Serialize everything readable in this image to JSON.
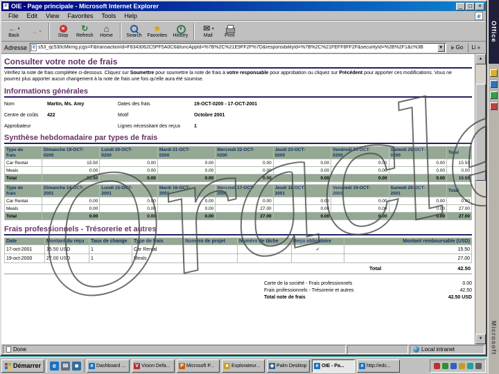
{
  "colors": {
    "titlebar_left": "#000080",
    "titlebar_right": "#1084d0",
    "chrome": "#c0c0c0",
    "desktop": "#008080",
    "heading": "#663366",
    "rule": "#202060",
    "table_header_bg": "#94a894",
    "table_header_text": "#14306a",
    "table_total_bg": "#94a894",
    "watermark_stroke": "#4a4a4a"
  },
  "window": {
    "title": "OIE - Page principale - Microsoft Internet Explorer",
    "menu_items": [
      "File",
      "Edit",
      "View",
      "Favorites",
      "Tools",
      "Help"
    ],
    "toolbar": [
      {
        "label": "Back",
        "icon": "back",
        "dropdown": true
      },
      {
        "label": "",
        "icon": "forward",
        "name": "forward",
        "dropdown": true,
        "disabled": true
      },
      {
        "sep": true
      },
      {
        "label": "Stop",
        "icon": "stop"
      },
      {
        "label": "Refresh",
        "icon": "refresh"
      },
      {
        "label": "Home",
        "icon": "home"
      },
      {
        "sep": true
      },
      {
        "label": "Search",
        "icon": "search"
      },
      {
        "label": "Favorites",
        "icon": "favorites"
      },
      {
        "label": "History",
        "icon": "history"
      },
      {
        "sep": true
      },
      {
        "label": "Mail",
        "icon": "mail",
        "dropdown": true
      },
      {
        "label": "Print",
        "icon": "print"
      }
    ],
    "address_label": "Adresse",
    "address_value": "s53_qc530cMkmg.jcgs=F&transactionId=F8343062C5PF5A0C6&funcAppId=%7B%2C%21E9FF2F%7D&responsibilityId=%7B%2C%21FEFF8FF2F&securityId=%2B%2F1&c%3B",
    "go_label": "Go",
    "links_label": "Li"
  },
  "page": {
    "title": "Consulter votre note de frais",
    "intro": [
      {
        "t": "Vérifiez la note de frais complétée ci-dessous. Cliquez sur "
      },
      {
        "t": "Soumettre",
        "b": true
      },
      {
        "t": " pour soumettre la note de frais à "
      },
      {
        "t": "votre responsable",
        "b": true
      },
      {
        "t": " pour approbation ou cliquez sur "
      },
      {
        "t": "Précédent",
        "b": true
      },
      {
        "t": " pour apporter ces modifications. Vous ne pourrez plus apporter aucun changement à la note de frais une fois qu'elle aura été soumise."
      }
    ],
    "general": {
      "title": "Informations générales",
      "fields_left": [
        {
          "label": "Nom",
          "value": "Martin, Ms. Amy"
        },
        {
          "label": "Centre de coûts",
          "value": "422"
        },
        {
          "label": "Approbateur",
          "value": ""
        }
      ],
      "fields_right": [
        {
          "label": "Dates des frais",
          "value": "19-OCT-0200  -  17-OCT-2001"
        },
        {
          "label": "Motif",
          "value": "Octobre 2001"
        },
        {
          "label": "Lignes nécessitant des reçus",
          "value": "1"
        }
      ]
    },
    "weekly_title": "Synthèse hebdomadaire par types de frais",
    "weeks": [
      {
        "headers": [
          [
            "Type de",
            "frais"
          ],
          [
            "Dimanche 19-OCT-",
            "0200"
          ],
          [
            "Lundi 20-OCT-",
            "0200"
          ],
          [
            "Mardi 21-OCT-",
            "0200"
          ],
          [
            "Mercredi 22-OCT-",
            "0200"
          ],
          [
            "Jeudi 23-OCT-",
            "0200"
          ],
          [
            "Vendredi 24-OCT-",
            "0200"
          ],
          [
            "Samedi 25-OCT-",
            "0200"
          ],
          [
            "Total"
          ]
        ],
        "rows": [
          {
            "label": "Car Rental",
            "values": [
              "15.50",
              "0.00",
              "0.00",
              "0.00",
              "0.00",
              "0.00",
              "0.00",
              "15.50"
            ]
          },
          {
            "label": "Meals",
            "values": [
              "0.00",
              "0.00",
              "0.00",
              "0.00",
              "0.00",
              "0.00",
              "0.00",
              "0.00"
            ]
          }
        ],
        "total": {
          "label": "Total",
          "values": [
            "15.50",
            "0.00",
            "0.00",
            "0.00",
            "0.00",
            "0.00",
            "0.00",
            "15.50"
          ]
        }
      },
      {
        "headers": [
          [
            "Type de",
            "frais"
          ],
          [
            "Dimanche 14-OCT-",
            "2001"
          ],
          [
            "Lundi 15-OCT-",
            "2001"
          ],
          [
            "Mardi 16-OCT-",
            "2001"
          ],
          [
            "Mercredi 17-OCT-",
            "2001"
          ],
          [
            "Jeudi 18-OCT-",
            "2001"
          ],
          [
            "Vendredi 19-OCT-",
            "2001"
          ],
          [
            "Samedi 20-OCT-",
            "2001"
          ],
          [
            "Total"
          ]
        ],
        "rows": [
          {
            "label": "Car Rental",
            "values": [
              "0.00",
              "0.00",
              "0.00",
              "0.00",
              "0.00",
              "0.00",
              "0.00",
              "0.00"
            ]
          },
          {
            "label": "Meals",
            "values": [
              "0.00",
              "0.00",
              "0.00",
              "27.00",
              "0.00",
              "0.00",
              "0.00",
              "27.00"
            ]
          }
        ],
        "total": {
          "label": "Total",
          "values": [
            "0.00",
            "0.00",
            "0.00",
            "27.00",
            "0.00",
            "0.00",
            "0.00",
            "27.00"
          ]
        }
      }
    ],
    "details": {
      "title": "Frais professionnels - Trésorerie et autres",
      "headers": [
        "Date",
        "Montant du reçu",
        "Taux de change",
        "Type de frais",
        "Numéro de projet",
        "Numéro de tâche",
        "Reçu obligatoire",
        "Montant remboursable (USD)"
      ],
      "rows": [
        [
          "17-oct-2001",
          "15.50 USD",
          "1",
          "Car Rental",
          "",
          "",
          "✓",
          "15.50"
        ],
        [
          "19-oct-2000",
          "27.00 USD",
          "1",
          "Meals",
          "",
          "",
          "",
          "27.00"
        ]
      ],
      "total_label": "Total",
      "total_value": "42.50",
      "summary": [
        {
          "label": "Carte de la société - Frais professionnels",
          "value": "0.00"
        },
        {
          "label": "Frais professionnels - Trésorerie et autres",
          "value": "42.50"
        },
        {
          "label": "Total note de frais",
          "value": "42.50 USD",
          "bold": true
        }
      ]
    }
  },
  "statusbar": {
    "status": "Done",
    "zone": "Local intranet"
  },
  "taskbar": {
    "start_label": "Démarrer",
    "quick_launch": [
      {
        "name": "ie-quicklaunch-icon",
        "glyph": "e",
        "color": "#1a73c0"
      },
      {
        "name": "outlook-quicklaunch-icon",
        "glyph": "✉",
        "color": "#607080"
      },
      {
        "name": "show-desktop-quicklaunch-icon",
        "glyph": "■",
        "color": "#2e6e9e"
      }
    ],
    "tasks": [
      {
        "label": "Dashboard ...",
        "glyph": "e",
        "color": "#1a73c0"
      },
      {
        "label": "Vision Defa...",
        "glyph": "V",
        "color": "#b03030"
      },
      {
        "label": "Microsoft P...",
        "glyph": "P",
        "color": "#c06018"
      },
      {
        "label": "Explorateur...",
        "glyph": "■",
        "color": "#c8a020"
      },
      {
        "label": "Palm Desktop",
        "glyph": "◆",
        "color": "#306090"
      },
      {
        "label": "OIE - Pa...",
        "glyph": "e",
        "color": "#1a73c0",
        "active": true
      },
      {
        "label": "http://edc...",
        "glyph": "e",
        "color": "#1a73c0"
      }
    ],
    "tray": [
      {
        "name": "tray-icon-1",
        "color": "#c03030"
      },
      {
        "name": "tray-icon-2",
        "color": "#309030"
      },
      {
        "name": "tray-icon-3",
        "color": "#3060c0"
      },
      {
        "name": "tray-icon-4",
        "color": "#c0a020"
      },
      {
        "name": "tray-icon-5",
        "color": "#20a0a0"
      },
      {
        "name": "tray-icon-6",
        "color": "#606060"
      }
    ]
  },
  "sidebar": {
    "title": "Office",
    "brand": "Microsoft",
    "icons": [
      {
        "name": "office-shortcut-icon-1",
        "color": "#e0b020"
      },
      {
        "name": "office-shortcut-icon-2",
        "color": "#3070c0"
      },
      {
        "name": "office-shortcut-icon-3",
        "color": "#30a050"
      },
      {
        "name": "office-shortcut-icon-4",
        "color": "#c04040"
      }
    ]
  },
  "watermark": {
    "text": "Oracle"
  }
}
